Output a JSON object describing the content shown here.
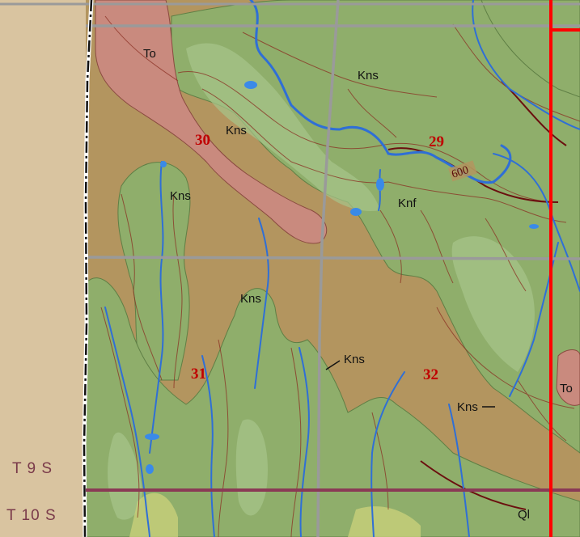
{
  "map": {
    "section_numbers": [
      "30",
      "29",
      "31",
      "32"
    ],
    "unit_labels": {
      "to_nw": "To",
      "kns_ne": "Kns",
      "kns_30": "Kns",
      "kns_w": "Kns",
      "knf": "Knf",
      "kns_31": "Kns",
      "kns_mid": "Kns",
      "kns_se": "Kns",
      "to_e": "To",
      "ql": "Ql"
    },
    "contour_label": "600",
    "township_labels": {
      "upper": "T 9 S",
      "lower": "T 10 S"
    },
    "colors": {
      "margin": "#d9c4a0",
      "plain": "#b3955f",
      "terrace_green": "#8fae6b",
      "tertiary_pink": "#c98a7e",
      "water": "#2f6fd6",
      "contour": "#8a2f22",
      "section_line": "#9a9a9a",
      "township_line": "#8a3a55",
      "range_line": "#ff0000",
      "section_number": "#c00000"
    }
  }
}
